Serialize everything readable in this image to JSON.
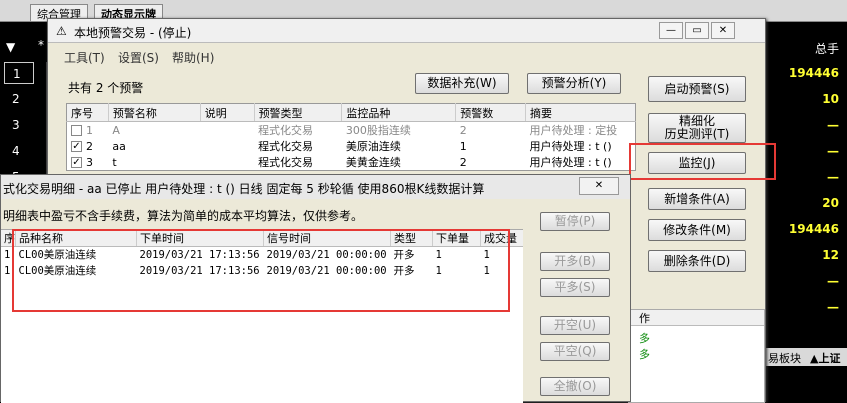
{
  "bg": {
    "tabs": [
      "综合管理",
      "动态显示牌"
    ],
    "col_header": "总手",
    "row_numbers": [
      "1",
      "2",
      "3",
      "4",
      "5"
    ],
    "values": [
      "194446",
      "10",
      "—",
      "—",
      "—",
      "20",
      "194446",
      "12",
      "—",
      "—"
    ],
    "bottom_tabs": [
      "易板块",
      "▲上证"
    ],
    "side_labels": [
      "作",
      "多",
      "多"
    ]
  },
  "main": {
    "title": "本地预警交易 - (停止)",
    "menu": [
      "工具(T)",
      "设置(S)",
      "帮助(H)"
    ],
    "count_text": "共有 2 个预警",
    "btn_supplement": "数据补充(W)",
    "btn_analysis": "预警分析(Y)",
    "grid_headers": [
      "序号",
      "预警名称",
      "说明",
      "预警类型",
      "监控品种",
      "预警数",
      "摘要"
    ],
    "rows": [
      {
        "check": "",
        "idx": "1",
        "name": "A",
        "desc": "",
        "type": "程式化交易",
        "symbol": "300股指连续",
        "count": "2",
        "summary": "用户待处理 : 定投"
      },
      {
        "check": "✓",
        "idx": "2",
        "name": "aa",
        "desc": "",
        "type": "程式化交易",
        "symbol": "美原油连续",
        "count": "1",
        "summary": "用户待处理 : t ()"
      },
      {
        "check": "✓",
        "idx": "3",
        "name": "t",
        "desc": "",
        "type": "程式化交易",
        "symbol": "美黄金连续",
        "count": "2",
        "summary": "用户待处理 : t ()"
      }
    ],
    "side_buttons": {
      "start": "启动预警(S)",
      "detail_1": "精细化",
      "detail_2": "历史测评(T)",
      "monitor": "监控(J)",
      "add": "新增条件(A)",
      "modify": "修改条件(M)",
      "delete": "删除条件(D)"
    }
  },
  "detail": {
    "title": "式化交易明细 - aa 已停止  用户待处理 : t () 日线 固定每 5 秒轮循 使用860根K线数据计算",
    "note": "明细表中盈亏不含手续费，算法为简单的成本平均算法，仅供参考。",
    "close_label": "✕",
    "headers": [
      "序",
      "品种名称",
      "下单时间",
      "信号时间",
      "类型",
      "下单量",
      "成交量"
    ],
    "rows": [
      {
        "idx": "1",
        "name": "CL00美原油连续",
        "order_time": "2019/03/21 17:13:56",
        "signal_time": "2019/03/21 00:00:00",
        "type": "开多",
        "qty": "1",
        "filled": "1"
      },
      {
        "idx": "1",
        "name": "CL00美原油连续",
        "order_time": "2019/03/21 17:13:56",
        "signal_time": "2019/03/21 00:00:00",
        "type": "开多",
        "qty": "1",
        "filled": "1"
      }
    ],
    "buttons": [
      "暂停(P)",
      "开多(B)",
      "平多(S)",
      "开空(U)",
      "平空(Q)",
      "全撤(O)"
    ]
  }
}
